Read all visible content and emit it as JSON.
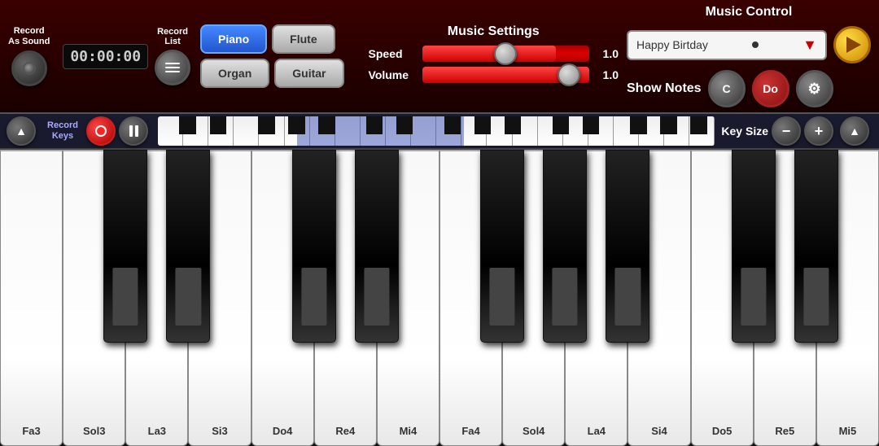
{
  "header": {
    "record_as_sound_label": "Record\nAs Sound",
    "timer": "00:00:00",
    "record_list_label": "Record\nList",
    "instruments": [
      "Piano",
      "Flute",
      "Organ",
      "Guitar"
    ],
    "active_instrument": "Piano",
    "music_settings": {
      "title": "Music Settings",
      "speed_label": "Speed",
      "speed_value": "1.0",
      "volume_label": "Volume",
      "volume_value": "1.0"
    },
    "music_control": {
      "title": "Music Control",
      "song_name": "Happy Birtday",
      "show_notes_label": "Show Notes",
      "note_c_label": "C",
      "note_do_label": "Do"
    }
  },
  "controls_bar": {
    "record_keys_label": "Record\nKeys",
    "key_size_label": "Key Size"
  },
  "piano": {
    "white_keys": [
      "Fa3",
      "Sol3",
      "La3",
      "Si3",
      "Do4",
      "Re4",
      "Mi4",
      "Fa4",
      "Sol4",
      "La4",
      "Si4",
      "Do5",
      "Re5",
      "Mi5"
    ],
    "note_c_label": "C",
    "note_do_label": "Do"
  }
}
